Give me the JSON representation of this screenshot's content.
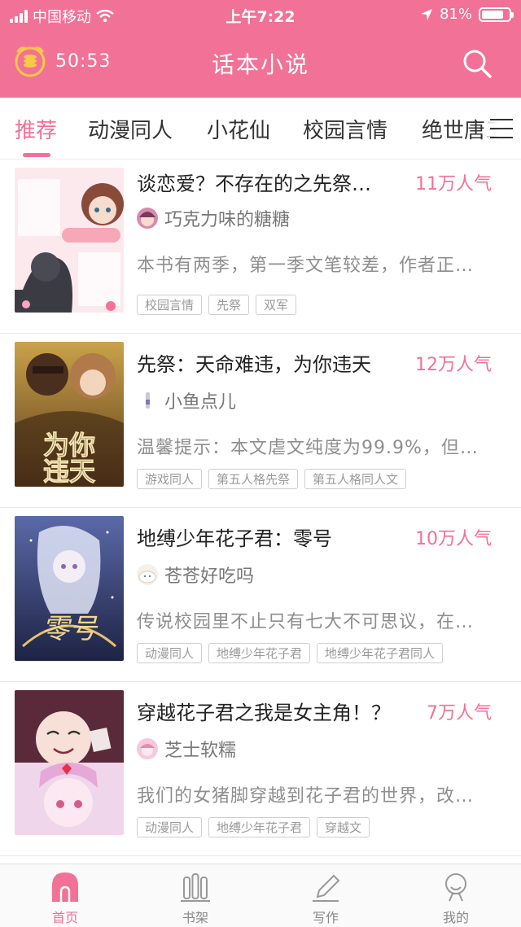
{
  "status_bar": {
    "carrier": "中国移动",
    "time": "上午7:22",
    "battery": "81%",
    "battery_level": 0.81
  },
  "header": {
    "timer": "50:53",
    "title": "话本小说"
  },
  "category_tabs": [
    {
      "label": "推荐",
      "active": true
    },
    {
      "label": "动漫同人",
      "active": false
    },
    {
      "label": "小花仙",
      "active": false
    },
    {
      "label": "校园言情",
      "active": false
    },
    {
      "label": "绝世唐三",
      "active": false
    }
  ],
  "books": [
    {
      "title": "谈恋爱？不存在的之先祭…",
      "popularity": "11万人气",
      "author": "巧克力味的糖糖",
      "intro": "本书有两季，第一季文笔较差，作者正…",
      "tags": [
        "校园言情",
        "先祭",
        "双军"
      ]
    },
    {
      "title": "先祭：天命难违，为你违天",
      "popularity": "12万人气",
      "author": "小鱼点儿",
      "intro": "温馨提示：本文虐文纯度为99.9%，但…",
      "tags": [
        "游戏同人",
        "第五人格先祭",
        "第五人格同人文"
      ]
    },
    {
      "title": "地缚少年花子君：零号",
      "popularity": "10万人气",
      "author": "苍苍好吃吗",
      "intro": "传说校园里不止只有七大不可思议，在…",
      "tags": [
        "动漫同人",
        "地缚少年花子君",
        "地缚少年花子君同人"
      ]
    },
    {
      "title": "穿越花子君之我是女主角！？",
      "popularity": "7万人气",
      "author": "芝士软糯",
      "intro": "我们的女猪脚穿越到花子君的世界，改…",
      "tags": [
        "动漫同人",
        "地缚少年花子君",
        "穿越文"
      ]
    }
  ],
  "bottom_nav": [
    {
      "label": "首页",
      "icon": "home-icon",
      "active": true
    },
    {
      "label": "书架",
      "icon": "bookshelf-icon",
      "active": false
    },
    {
      "label": "写作",
      "icon": "pen-icon",
      "active": false
    },
    {
      "label": "我的",
      "icon": "profile-icon",
      "active": false
    }
  ],
  "colors": {
    "accent": "#f27196",
    "header_bg": "#f27196",
    "tag_border": "#cfcfcf",
    "text_muted": "#8e8e8e"
  }
}
